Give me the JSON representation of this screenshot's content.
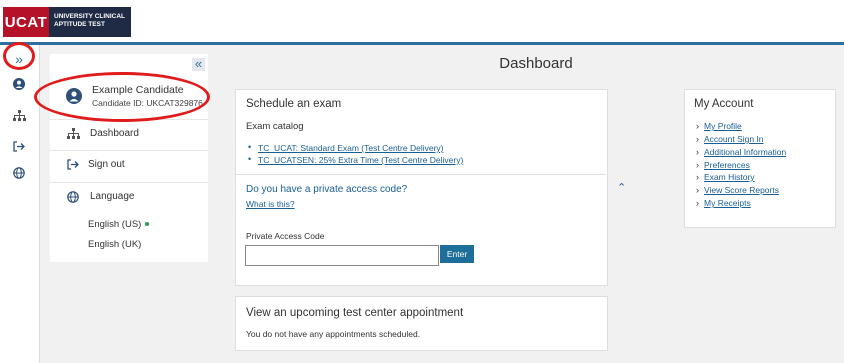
{
  "logo": {
    "brand": "UCAT",
    "subtitle_line1": "UNIVERSITY CLINICAL",
    "subtitle_line2": "APTITUDE TEST"
  },
  "page_title": "Dashboard",
  "rail": {
    "items": [
      {
        "icon": "expand-chevrons-icon",
        "glyph": "»"
      },
      {
        "icon": "user-circle-icon",
        "glyph": "●"
      },
      {
        "icon": "sitemap-icon",
        "glyph": "⊶"
      },
      {
        "icon": "sign-out-icon",
        "glyph": "↦"
      },
      {
        "icon": "globe-icon",
        "glyph": "⊕"
      }
    ]
  },
  "sidebar": {
    "collapse_glyph": "«",
    "user": {
      "name": "Example Candidate",
      "candidate_id": "Candidate ID: UKCAT329876"
    },
    "dashboard": "Dashboard",
    "sign_out": "Sign out",
    "language": "Language",
    "languages": [
      "English (US)",
      "English (UK)"
    ]
  },
  "schedule": {
    "title": "Schedule an exam",
    "catalog_label": "Exam catalog",
    "exams": [
      "TC_UCAT: Standard Exam (Test Centre Delivery)",
      "TC_UCATSEN: 25% Extra Time (Test Centre Delivery)"
    ],
    "private_code_question": "Do you have a private access code?",
    "what_is_this": "What is this?",
    "private_code_label": "Private Access Code",
    "private_code_value": "",
    "enter_button": "Enter"
  },
  "appointments": {
    "title": "View an upcoming test center appointment",
    "message": "You do not have any appointments scheduled."
  },
  "account": {
    "title": "My Account",
    "links": [
      "My Profile",
      "Account Sign In",
      "Additional Information",
      "Preferences",
      "Exam History",
      "View Score Reports",
      "My Receipts"
    ]
  },
  "colors": {
    "brand_red": "#b5122a",
    "brand_navy": "#1f2a44",
    "accent_blue": "#2d6f9e",
    "link_blue": "#1a5f93",
    "annotation_red": "#e01b1b",
    "selected_green": "#27a34a"
  }
}
